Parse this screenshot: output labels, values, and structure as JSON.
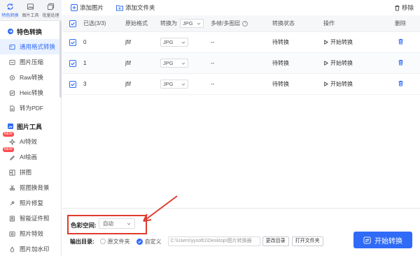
{
  "rail": {
    "items": [
      {
        "label": "特色转换",
        "icon": "refresh-icon"
      },
      {
        "label": "图片工具",
        "icon": "image-icon"
      },
      {
        "label": "批量处理",
        "icon": "batch-icon"
      }
    ]
  },
  "nav": {
    "group1": "特色转换",
    "items1": [
      {
        "label": "通用格式转换"
      },
      {
        "label": "图片压缩"
      },
      {
        "label": "Raw转换"
      },
      {
        "label": "Heic转换"
      },
      {
        "label": "转为PDF"
      }
    ],
    "group2": "图片工具",
    "items2": [
      {
        "label": "AI特效",
        "badge": "NEW"
      },
      {
        "label": "AI绘画",
        "badge": "NEW"
      },
      {
        "label": "拼图"
      },
      {
        "label": "抠图换背景"
      },
      {
        "label": "照片修复"
      },
      {
        "label": "智能证件照"
      },
      {
        "label": "照片特效"
      },
      {
        "label": "图片加水印"
      }
    ]
  },
  "toolbar": {
    "add_image": "添加图片",
    "add_folder": "添加文件夹",
    "remove": "移除"
  },
  "table": {
    "headers": {
      "selected": "已选(3/3)",
      "original_format": "原始格式",
      "convert_to": "转换为",
      "convert_to_value": "JPG",
      "multi": "多帧/多图层",
      "status": "转换状态",
      "operation": "操作",
      "delete": "删除"
    },
    "rows": [
      {
        "name": "0",
        "format": "jfif",
        "target": "JPG",
        "multi": "--",
        "status": "待转换",
        "action": "开始转换"
      },
      {
        "name": "1",
        "format": "jfif",
        "target": "JPG",
        "multi": "--",
        "status": "待转换",
        "action": "开始转换"
      },
      {
        "name": "3",
        "format": "jfif",
        "target": "JPG",
        "multi": "--",
        "status": "待转换",
        "action": "开始转换"
      }
    ]
  },
  "bottom": {
    "color_space_label": "色彩空间:",
    "color_space_value": "自动",
    "output_label": "输出目录:",
    "opt_original": "原文件夹",
    "opt_custom": "自定义",
    "path": "C:\\Users\\yysoft1\\Desktop\\图片转换器",
    "change_dir": "更改目录",
    "open_folder": "打开文件夹",
    "start": "开始转换"
  },
  "colors": {
    "accent": "#2f6bf6",
    "highlight": "#e03b2e",
    "badge": "#ff4d4f"
  }
}
